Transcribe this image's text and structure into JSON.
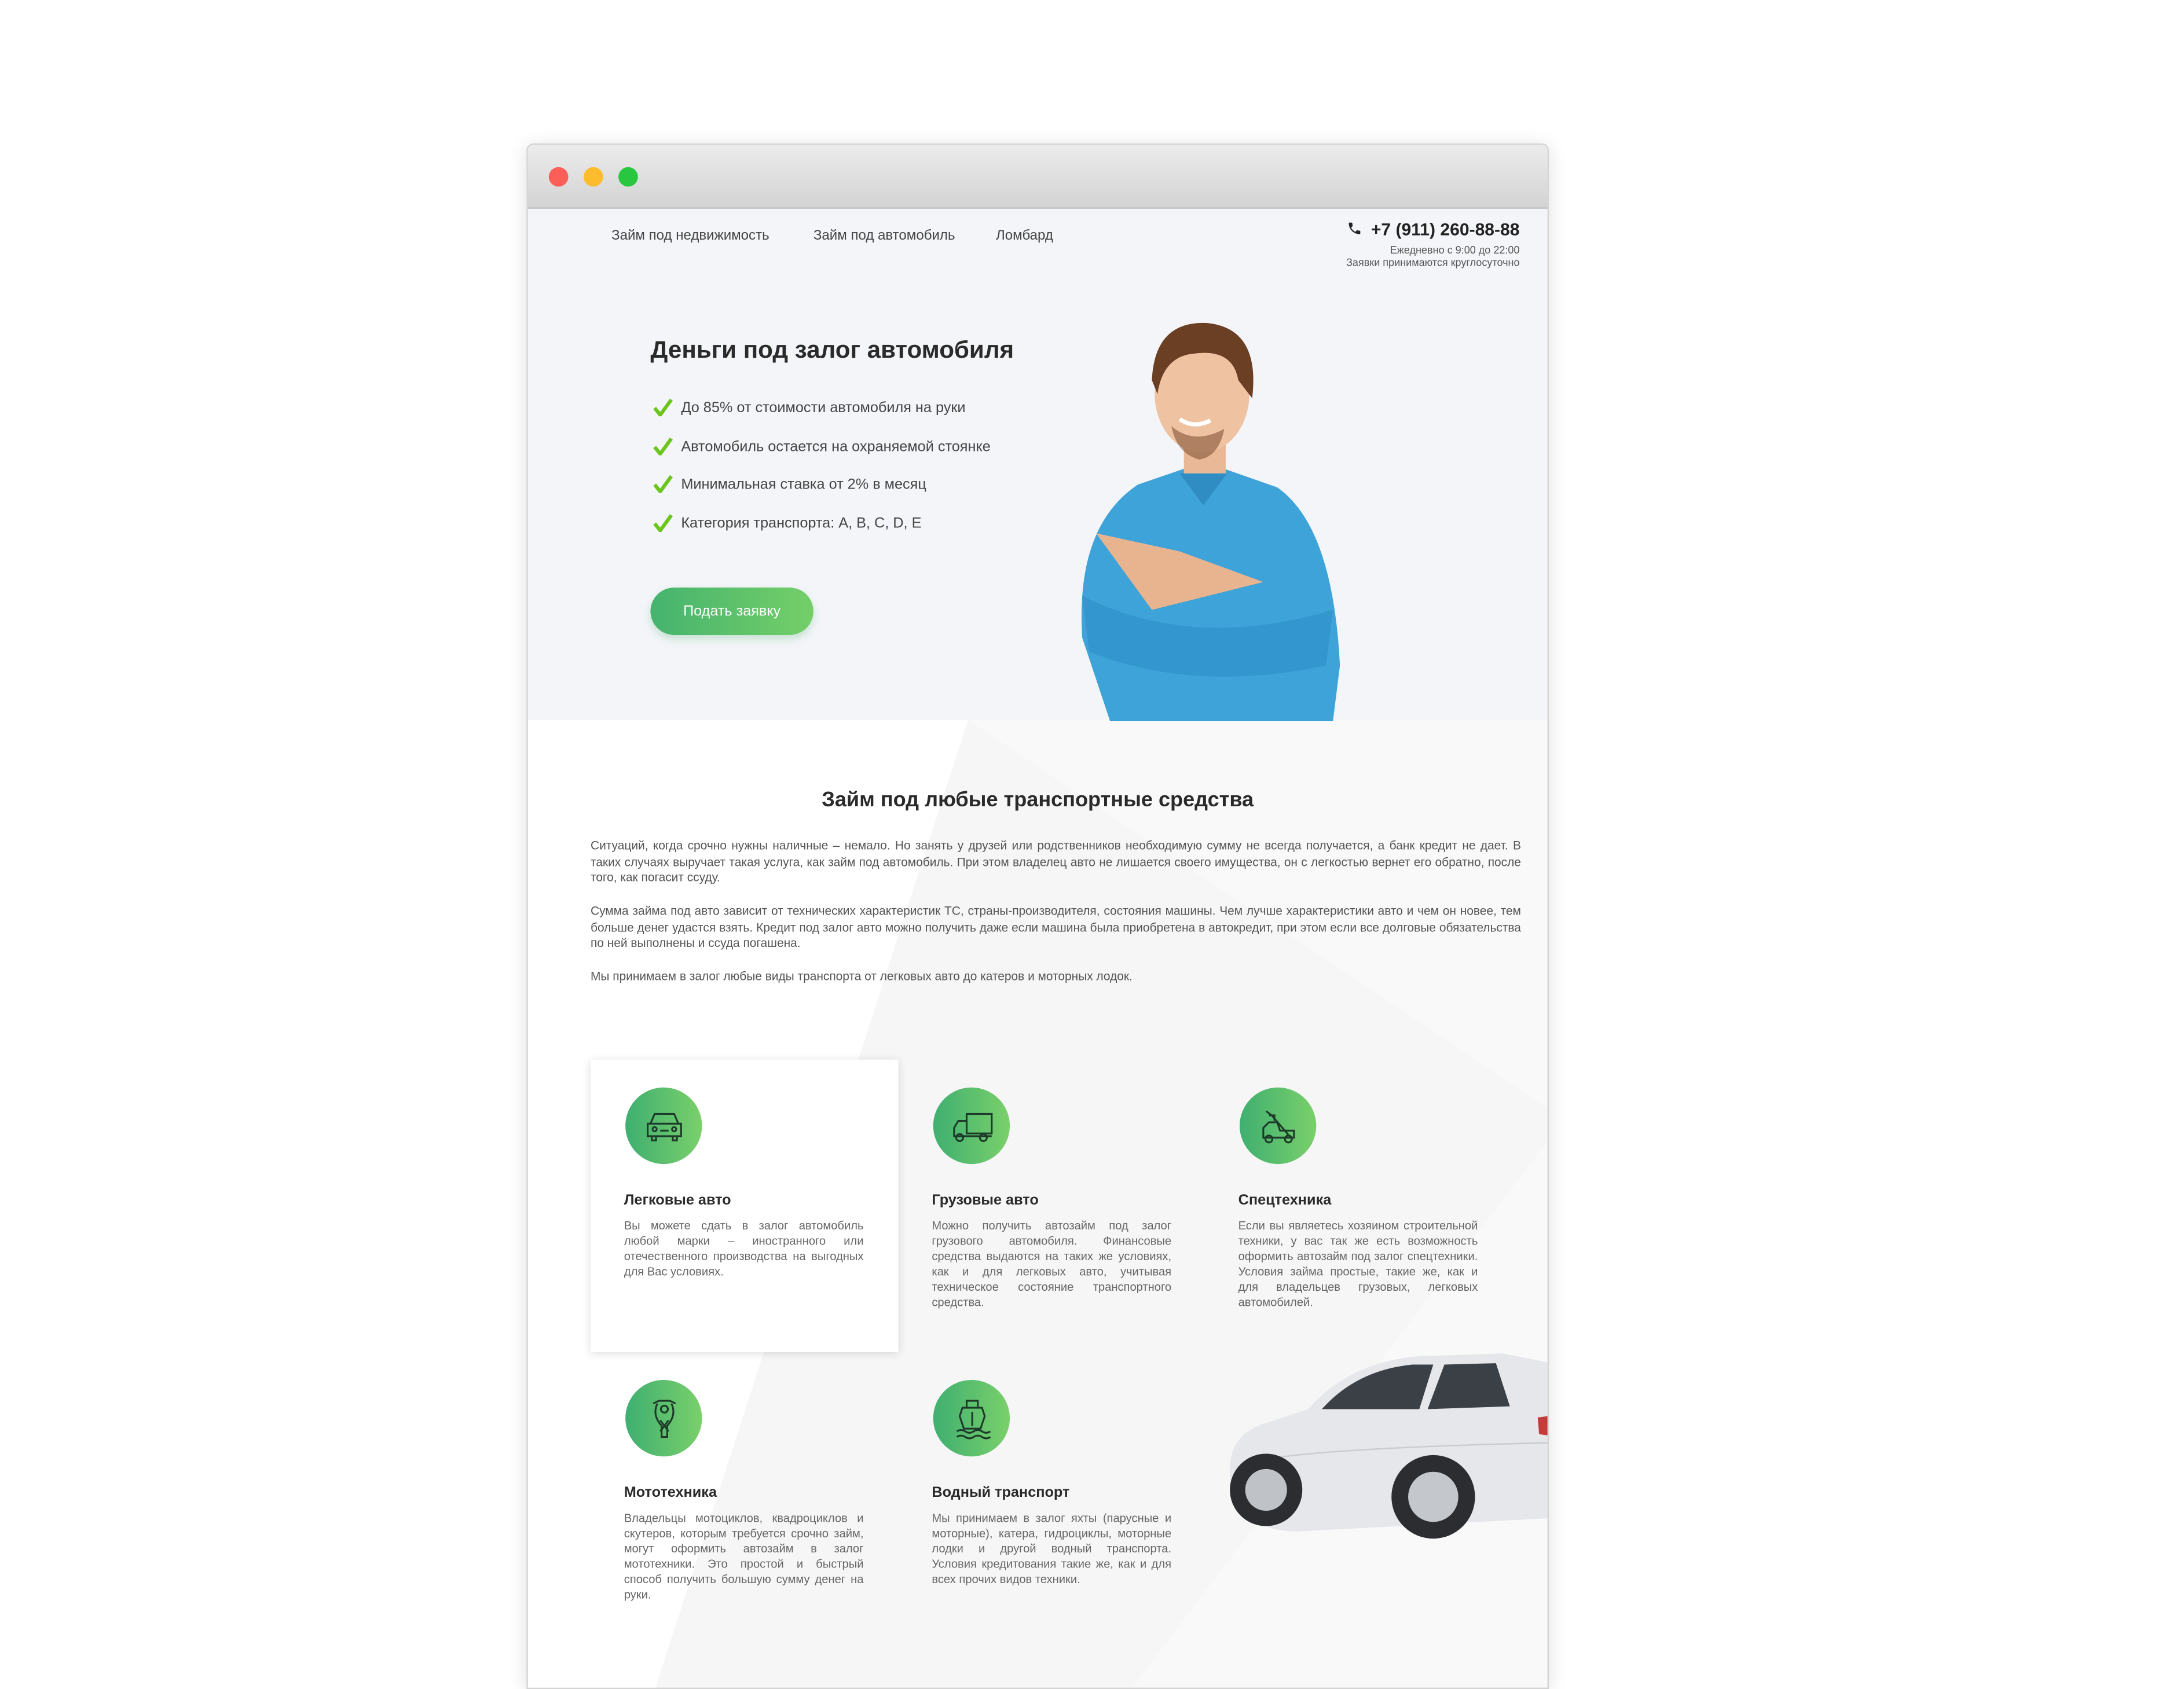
{
  "window": {
    "traffic_lights": {
      "close": "#fc5f57",
      "minimize": "#fdbc2e",
      "maximize": "#29c73f"
    }
  },
  "nav": {
    "items": [
      {
        "label": "Займ под недвижимость"
      },
      {
        "label": "Займ под автомобиль"
      },
      {
        "label": "Ломбард"
      }
    ]
  },
  "contact": {
    "phone": "+7 (911) 260-88-88",
    "hours": "Ежедневно с 9:00 до 22:00",
    "note": "Заявки принимаются круглосуточно",
    "icon": "phone-icon"
  },
  "hero": {
    "title": "Деньги под залог автомобиля",
    "benefits": [
      "До 85% от стоимости автомобиля на руки",
      "Автомобиль остается на охраняемой стоянке",
      "Минимальная ставка от 2% в месяц",
      "Категория транспорта: A, B, C, D, E"
    ],
    "button": "Подать заявку",
    "accent": "#5cc26c"
  },
  "section": {
    "title": "Займ под любые транспортные средства",
    "paragraphs": [
      "Ситуаций, когда срочно нужны наличные – немало. Но занять у друзей или родственников необходимую сумму не всегда получается, а банк кредит не дает. В таких случаях выручает такая услуга, как займ под автомобиль. При этом владелец авто не лишается своего имущества, он с легкостью вернет его обратно, после того, как погасит ссуду.",
      "Сумма займа под авто зависит от технических характеристик ТС, страны-производителя, состояния машины. Чем лучше характеристики авто и чем он новее, тем больше денег удастся взять. Кредит под залог авто можно получить даже если машина была приобретена в автокредит, при этом если все долговые обязательства по ней выполнены и ссуда погашена.",
      "Мы принимаем в залог любые виды транспорта от легковых авто до катеров и моторных лодок."
    ]
  },
  "cards": [
    {
      "icon": "car-icon",
      "title": "Легковые авто",
      "text": "Вы можете сдать в залог автомобиль любой марки – иностранного или отечественного производства на выгодных для Вас условиях."
    },
    {
      "icon": "truck-icon",
      "title": "Грузовые авто",
      "text": "Можно получить автозайм под залог грузового автомобиля. Финансовые средства выдаются на таких же условиях, как и для легковых авто, учитывая техническое состояние транспортного средства."
    },
    {
      "icon": "tow-truck-icon",
      "title": "Спецтехника",
      "text": "Если вы являетесь хозяином строительной техники, у вас так же есть возможность оформить автозайм под залог спецтехники. Условия займа простые, такие же, как и для владельцев грузовых, легковых автомобилей."
    },
    {
      "icon": "motorcycle-icon",
      "title": "Мототехника",
      "text": "Владельцы мотоциклов, квадроциклов и скутеров, которым требуется срочно займ, могут оформить автозайм в залог мототехники. Это простой и быстрый способ получить большую сумму денег на руки."
    },
    {
      "icon": "ship-icon",
      "title": "Водный транспорт",
      "text": "Мы принимаем в залог яхты (парусные и моторные), катера, гидроциклы, моторные лодки и другой водный транспорта. Условия кредитования такие же, как и для всех прочих видов техники."
    }
  ]
}
